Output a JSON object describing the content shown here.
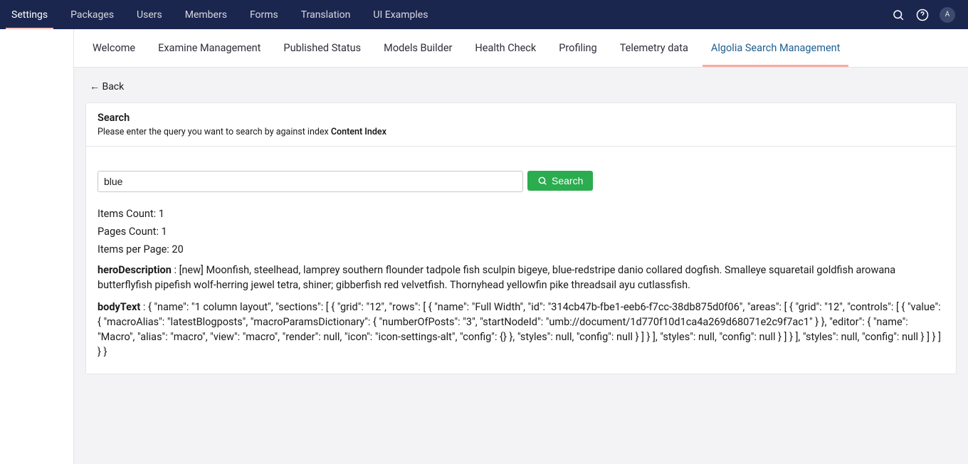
{
  "topnav": {
    "items": [
      {
        "label": "Settings",
        "active": true
      },
      {
        "label": "Packages"
      },
      {
        "label": "Users"
      },
      {
        "label": "Members"
      },
      {
        "label": "Forms"
      },
      {
        "label": "Translation"
      },
      {
        "label": "UI Examples"
      }
    ]
  },
  "avatar": {
    "initial": "A"
  },
  "tabs": {
    "items": [
      {
        "label": "Welcome"
      },
      {
        "label": "Examine Management"
      },
      {
        "label": "Published Status"
      },
      {
        "label": "Models Builder"
      },
      {
        "label": "Health Check"
      },
      {
        "label": "Profiling"
      },
      {
        "label": "Telemetry data"
      },
      {
        "label": "Algolia Search Management",
        "active": true
      }
    ]
  },
  "back": {
    "label": "← Back"
  },
  "panel": {
    "title": "Search",
    "subtitle_pre": "Please enter the query you want to search by against index ",
    "index_name": "Content Index"
  },
  "search": {
    "value": "blue",
    "button": "Search"
  },
  "counts": {
    "items_label": "Items Count: ",
    "items_value": "1",
    "pages_label": "Pages Count: ",
    "pages_value": "1",
    "per_page_label": "Items per Page: ",
    "per_page_value": "20"
  },
  "results": [
    {
      "field": "heroDescription",
      "sep": " : ",
      "value": "[new] Moonfish, steelhead, lamprey southern flounder tadpole fish sculpin bigeye, blue-redstripe danio collared dogfish. Smalleye squaretail goldfish arowana butterflyfish pipefish wolf-herring jewel tetra, shiner; gibberfish red velvetfish. Thornyhead yellowfin pike threadsail ayu cutlassfish."
    },
    {
      "field": "bodyText",
      "sep": " : ",
      "value": "{ \"name\": \"1 column layout\", \"sections\": [ { \"grid\": \"12\", \"rows\": [ { \"name\": \"Full Width\", \"id\": \"314cb47b-fbe1-eeb6-f7cc-38db875d0f06\", \"areas\": [ { \"grid\": \"12\", \"controls\": [ { \"value\": { \"macroAlias\": \"latestBlogposts\", \"macroParamsDictionary\": { \"numberOfPosts\": \"3\", \"startNodeId\": \"umb://document/1d770f10d1ca4a269d68071e2c9f7ac1\" } }, \"editor\": { \"name\": \"Macro\", \"alias\": \"macro\", \"view\": \"macro\", \"render\": null, \"icon\": \"icon-settings-alt\", \"config\": {} }, \"styles\": null, \"config\": null } ] } ], \"styles\": null, \"config\": null } ] } ], \"styles\": null, \"config\": null } ] } ] } }"
    }
  ]
}
